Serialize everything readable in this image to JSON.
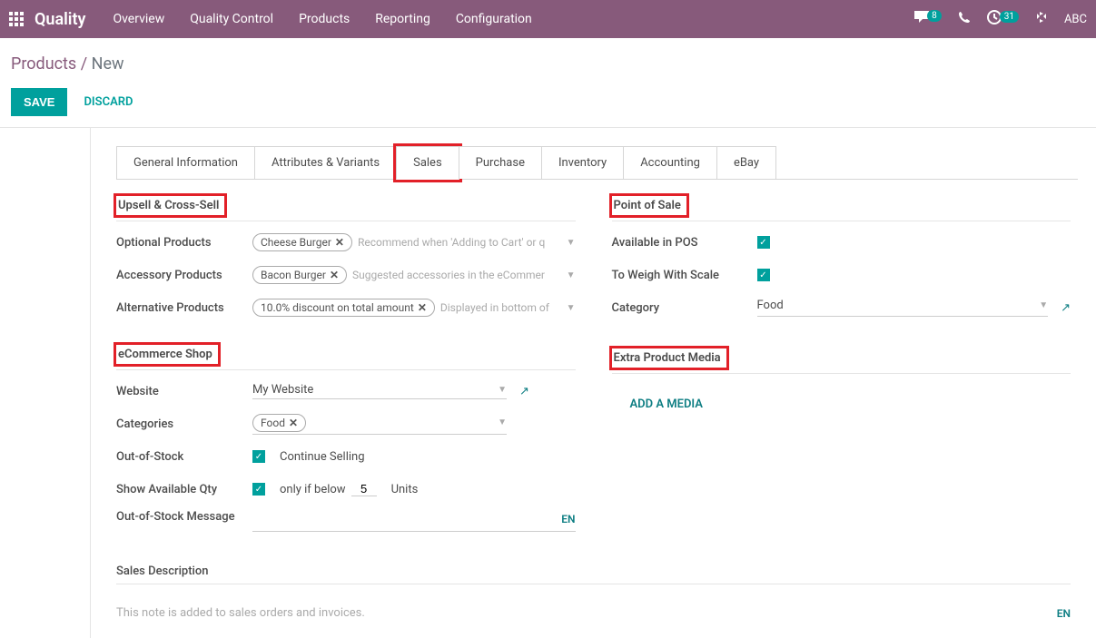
{
  "topbar": {
    "brand": "Quality",
    "nav": [
      "Overview",
      "Quality Control",
      "Products",
      "Reporting",
      "Configuration"
    ],
    "messages_badge": "8",
    "activity_badge": "31",
    "user": "ABC"
  },
  "breadcrumb": {
    "root": "Products",
    "current": "New"
  },
  "actions": {
    "save": "SAVE",
    "discard": "DISCARD"
  },
  "tabs": [
    "General Information",
    "Attributes & Variants",
    "Sales",
    "Purchase",
    "Inventory",
    "Accounting",
    "eBay"
  ],
  "active_tab": "Sales",
  "upsell": {
    "title": "Upsell & Cross-Sell",
    "optional_label": "Optional Products",
    "optional_tag": "Cheese Burger",
    "optional_placeholder": "Recommend when 'Adding to Cart' or q",
    "accessory_label": "Accessory Products",
    "accessory_tag": "Bacon Burger",
    "accessory_placeholder": "Suggested accessories in the eCommer",
    "alternative_label": "Alternative Products",
    "alternative_tag": "10.0% discount on total amount",
    "alternative_placeholder": "Displayed in bottom of"
  },
  "ecommerce": {
    "title": "eCommerce Shop",
    "website_label": "Website",
    "website_value": "My Website",
    "categories_label": "Categories",
    "categories_tag": "Food",
    "oos_label": "Out-of-Stock",
    "oos_text": "Continue Selling",
    "avail_label": "Show Available Qty",
    "avail_text": "only if below",
    "avail_value": "5",
    "avail_units": "Units",
    "oos_msg_label": "Out-of-Stock Message",
    "lang": "EN"
  },
  "pos": {
    "title": "Point of Sale",
    "available_label": "Available in POS",
    "weigh_label": "To Weigh With Scale",
    "category_label": "Category",
    "category_value": "Food"
  },
  "media": {
    "title": "Extra Product Media",
    "add": "ADD A MEDIA"
  },
  "sales_desc": {
    "title": "Sales Description",
    "placeholder": "This note is added to sales orders and invoices.",
    "lang": "EN"
  }
}
